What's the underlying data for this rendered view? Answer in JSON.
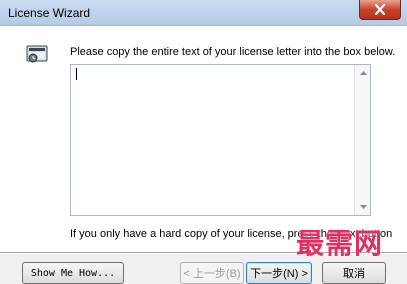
{
  "window": {
    "title": "License Wizard"
  },
  "content": {
    "instruction": "Please copy the entire text of your license letter into the box below.",
    "license_text": "",
    "hint": "If you only have a hard copy of your license, press the Next button"
  },
  "buttons": {
    "show_me_how": "Show Me How...",
    "back": "< 上一步(B)",
    "next": "下一步(N) >",
    "cancel": "取消"
  },
  "watermark": {
    "text": "最需网"
  },
  "colors": {
    "titlebar": "#b3cbe6",
    "close_button": "#c8442c",
    "watermark": "#e0305f"
  }
}
